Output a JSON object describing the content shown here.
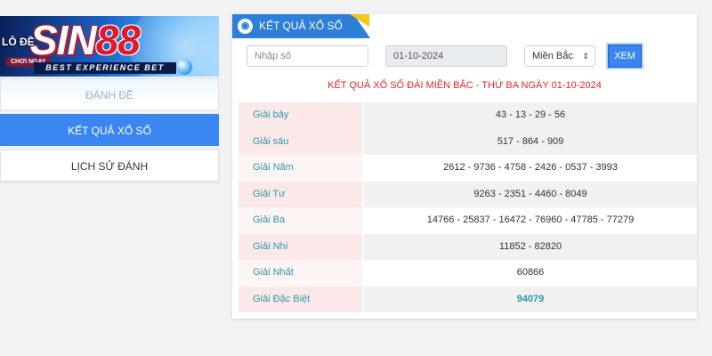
{
  "brand": {
    "logo_main": "SIN",
    "logo_num": "88",
    "tagline": "BEST EXPERIENCE BET",
    "promo_text": "LÔ ĐỀ",
    "promo_button": "CHƠI NGAY"
  },
  "sidebar": {
    "items": [
      {
        "label": "ĐÁNH ĐỀ"
      },
      {
        "label": "KẾT QUẢ XỔ SỐ"
      },
      {
        "label": "LỊCH SỬ ĐÁNH"
      }
    ]
  },
  "panel": {
    "tab_title": "KẾT QUẢ XỔ SỐ",
    "tab_icon": "lottery-ball-icon",
    "accent_color": "#2d7fd8"
  },
  "controls": {
    "search_placeholder": "Nhập số",
    "date_value": "01-10-2024",
    "region_value": "Miền Bắc",
    "submit_label": "XEM"
  },
  "result": {
    "title": "KẾT QUẢ XỔ SỐ ĐÀI MIỀN BẮC - THỨ BA NGÀY 01-10-2024",
    "title_color": "#e8232a",
    "rows": [
      {
        "label": "Giải bảy",
        "value": "43 - 13 - 29 - 56"
      },
      {
        "label": "Giải sáu",
        "value": "517 - 864 - 909"
      },
      {
        "label": "Giải Năm",
        "value": "2612 - 9736 - 4758 - 2426 - 0537 - 3993"
      },
      {
        "label": "Giải Tư",
        "value": "9263 - 2351 - 4460 - 8049"
      },
      {
        "label": "Giải Ba",
        "value": "14766 - 25837 - 16472 - 76960 - 47785 - 77279"
      },
      {
        "label": "Giải Nhì",
        "value": "11852 - 82820"
      },
      {
        "label": "Giải Nhất",
        "value": "60866"
      },
      {
        "label": "Giải Đặc Biệt",
        "value": "94079"
      }
    ]
  }
}
